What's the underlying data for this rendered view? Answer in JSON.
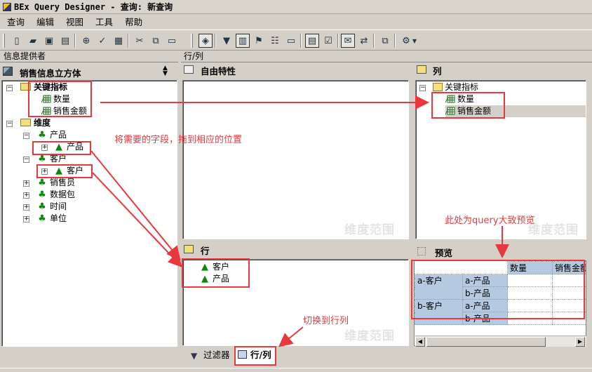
{
  "window": {
    "title": "BEx Query Designer - 查询: 新查询"
  },
  "menu": [
    "查询",
    "编辑",
    "视图",
    "工具",
    "帮助"
  ],
  "info_provider": {
    "header": "信息提供者",
    "cube": "销售信息立方体",
    "tree": {
      "key_figures": "关键指标",
      "kf_items": [
        "数量",
        "销售金额"
      ],
      "dimensions": "维度",
      "dim_product": "产品",
      "dim_product_child": "产品",
      "dim_customer": "客户",
      "dim_customer_child": "客户",
      "dim_others": [
        "销售员",
        "数据包",
        "时间",
        "单位"
      ]
    }
  },
  "rowcol": {
    "header": "行/列",
    "free_chars": "自由特性",
    "columns": {
      "title": "列",
      "root": "关键指标",
      "items": [
        "数量",
        "销售金额"
      ]
    },
    "rows": {
      "title": "行",
      "items": [
        "客户",
        "产品"
      ]
    },
    "preview": {
      "title": "预览",
      "col_headers": [
        "数量",
        "销售金额"
      ],
      "groups": [
        {
          "label": "a-客户",
          "rows": [
            "a-产品",
            "b-产品"
          ]
        },
        {
          "label": "b-客户",
          "rows": [
            "a-产品",
            "b-产品"
          ]
        }
      ]
    },
    "watermark": "维度范围"
  },
  "annotations": {
    "drag_hint": "将需要的字段，拖到相应的位置",
    "preview_hint": "此处为query大致预览",
    "switch_hint": "切换到行列"
  },
  "tabs": {
    "filter": "过滤器",
    "rowcol": "行/列"
  },
  "colors": {
    "annotation": "#e8383d",
    "preview_header": "#b5c9e0"
  }
}
